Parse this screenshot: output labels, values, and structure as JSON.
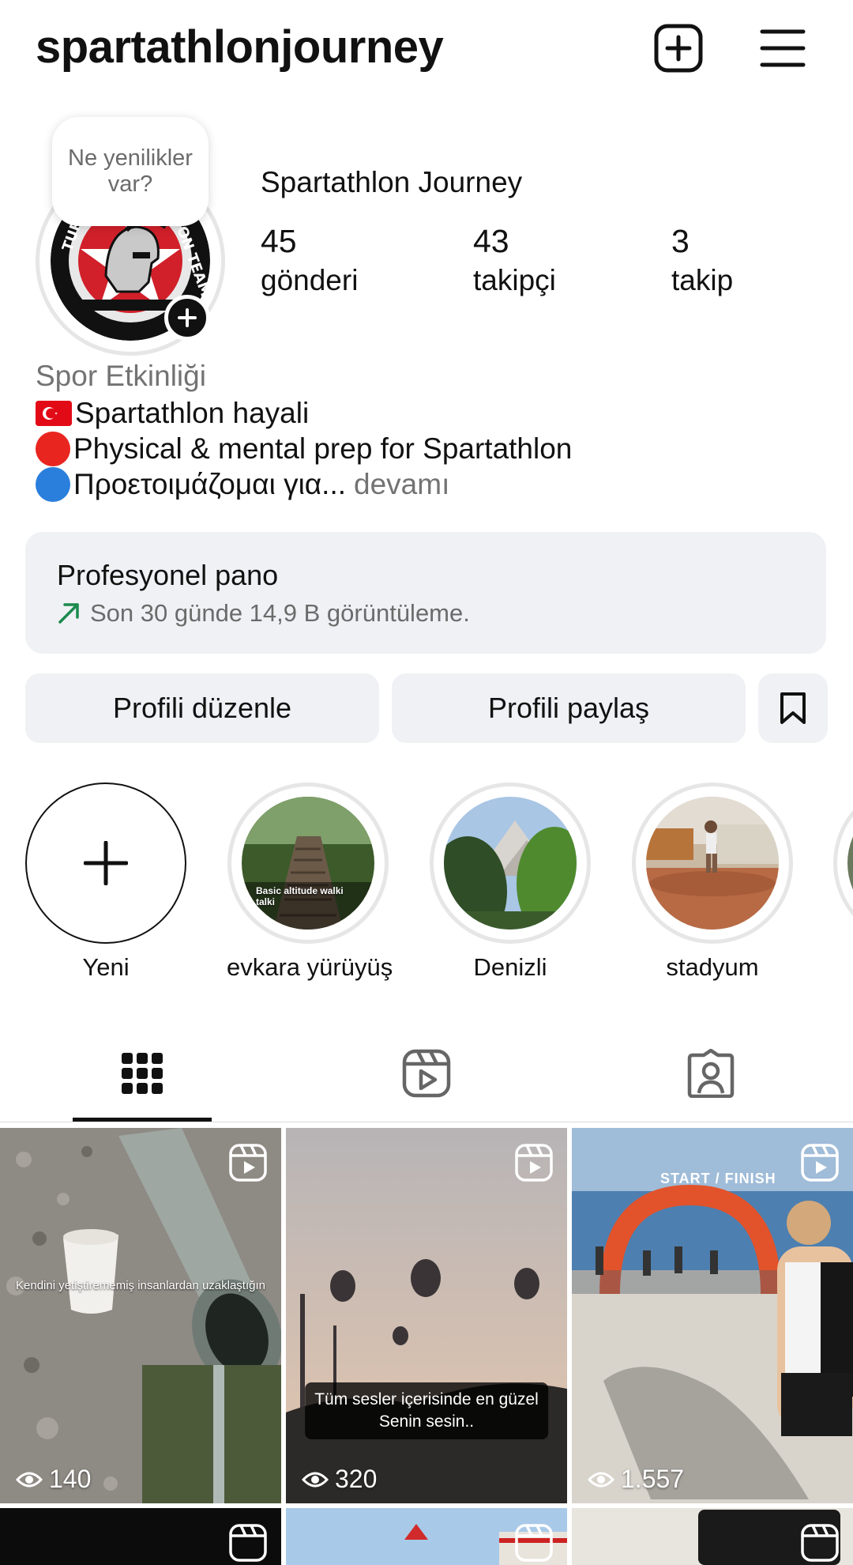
{
  "header": {
    "username": "spartathlonjourney",
    "icons": [
      "new-post-icon",
      "menu-icon"
    ]
  },
  "profile": {
    "note": "Ne yenilikler var?",
    "display_name": "Spartathlon Journey",
    "stats": [
      {
        "value": "45",
        "label": "gönderi"
      },
      {
        "value": "43",
        "label": "takipçi"
      },
      {
        "value": "3",
        "label": "takip"
      }
    ],
    "category": "Spor Etkinliği",
    "bio": [
      "Spartathlon hayali",
      "Physical & mental prep for Spartathlon",
      "Προετοιμάζομαι για..."
    ],
    "more_label": "devamı"
  },
  "dashboard": {
    "title": "Profesyonel pano",
    "subtitle": "Son 30 günde 14,9 B görüntüleme."
  },
  "actions": {
    "edit": "Profili düzenle",
    "share": "Profili paylaş"
  },
  "highlights": [
    {
      "label": "Yeni"
    },
    {
      "label": "evkara yürüyüş",
      "overlay": "Basic altitude walki talki"
    },
    {
      "label": "Denizli"
    },
    {
      "label": "stadyum"
    }
  ],
  "tabs": [
    "grid-icon",
    "reels-icon",
    "tagged-icon"
  ],
  "posts": [
    {
      "views": "140",
      "caption": "Kendini yetiştirememiş insanlardan uzaklaştığın"
    },
    {
      "views": "320",
      "caption_line1": "Tüm sesler içerisinde en güzel",
      "caption_line2": "Senin sesin.."
    },
    {
      "views": "1.557",
      "arch": "START / FINISH"
    }
  ],
  "colors": {
    "accent": "#0095f6",
    "text": "#111111",
    "muted": "#737373",
    "button_bg": "#eff1f4",
    "trend_green": "#1a8a4c"
  }
}
